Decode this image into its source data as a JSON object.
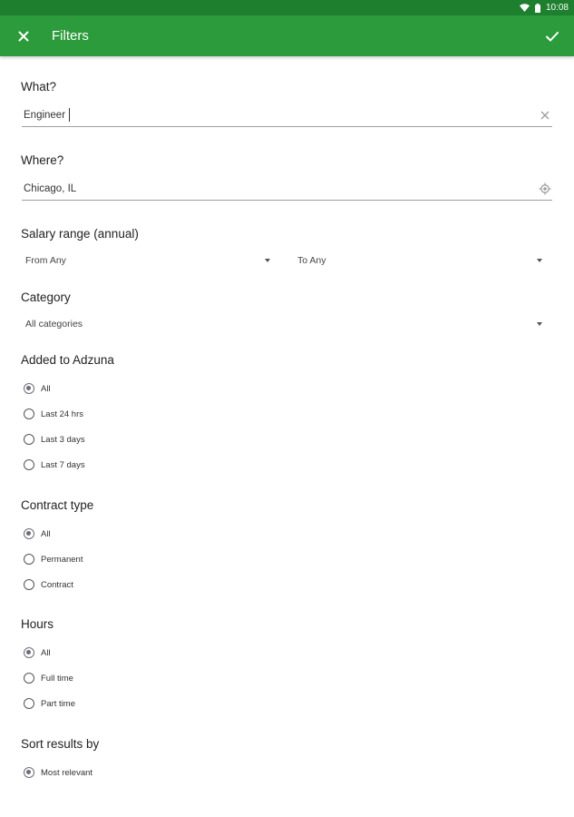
{
  "status": {
    "time": "10:08",
    "wifi_icon": "wifi-icon",
    "battery_icon": "battery-icon"
  },
  "appbar": {
    "title": "Filters",
    "close_icon": "close-icon",
    "confirm_icon": "check-icon",
    "color": "#2c9b3b"
  },
  "what": {
    "label": "What?",
    "value": "Engineer",
    "clear_icon": "clear-icon"
  },
  "where": {
    "label": "Where?",
    "value": "Chicago, IL",
    "location_icon": "my-location-icon"
  },
  "salary": {
    "label": "Salary range (annual)",
    "from": "From Any",
    "to": "To Any"
  },
  "category": {
    "label": "Category",
    "value": "All categories"
  },
  "added": {
    "label": "Added to Adzuna",
    "options": [
      "All",
      "Last 24 hrs",
      "Last 3 days",
      "Last 7 days"
    ],
    "selected": "All"
  },
  "contract": {
    "label": "Contract type",
    "options": [
      "All",
      "Permanent",
      "Contract"
    ],
    "selected": "All"
  },
  "hours": {
    "label": "Hours",
    "options": [
      "All",
      "Full time",
      "Part time"
    ],
    "selected": "All"
  },
  "sort": {
    "label": "Sort results by",
    "options": [
      "Most relevant"
    ],
    "selected": "Most relevant"
  }
}
